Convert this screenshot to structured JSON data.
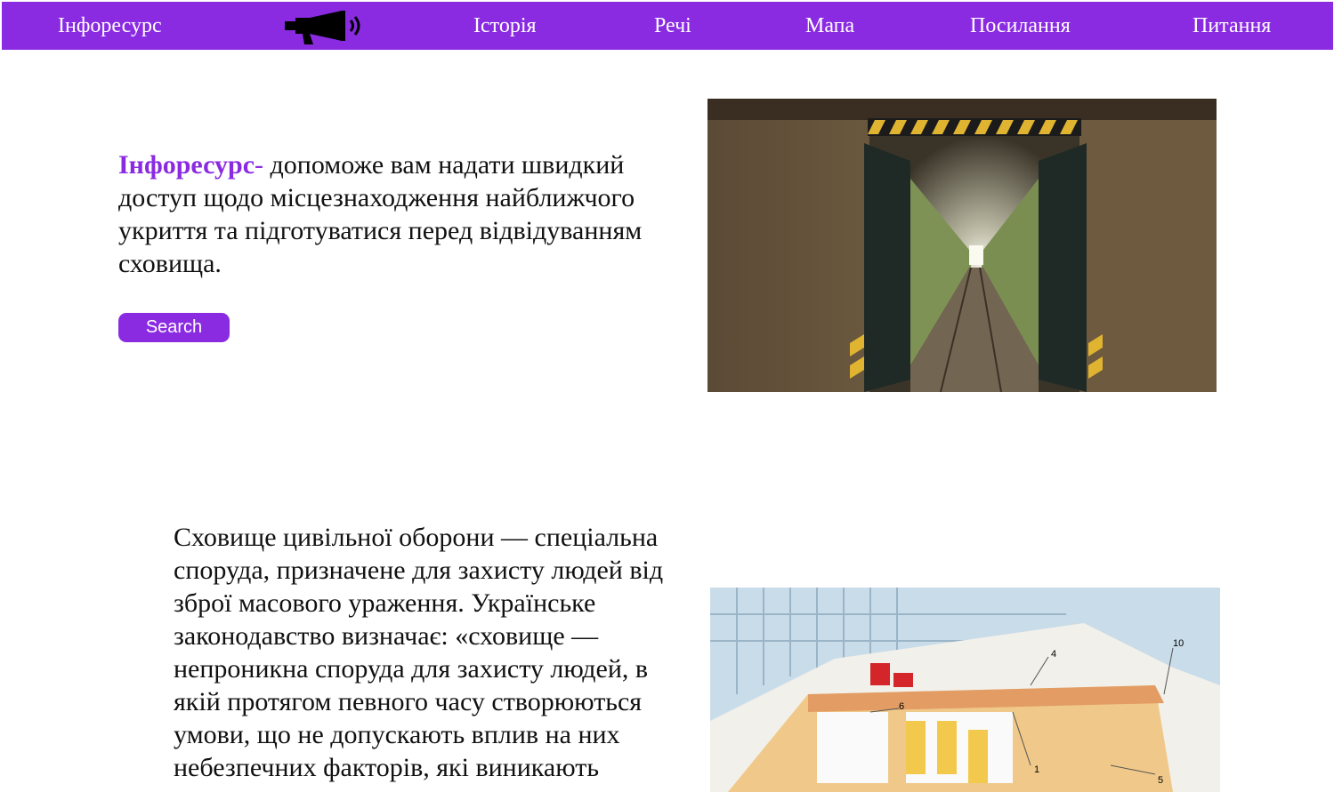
{
  "nav": {
    "brand": "Інфоресурс",
    "logo_icon": "megaphone-icon",
    "items": [
      "Історія",
      "Речі",
      "Мапа",
      "Посилання",
      "Питання"
    ]
  },
  "hero": {
    "brand_word": "Інфоресурс",
    "dash": "-",
    "text": " допоможе вам надати швидкий доступ щодо місцезнаходження найближчого укриття та підготуватися перед відвідуванням сховища.",
    "search_label": "Search"
  },
  "info": {
    "text": "Сховище цивільної оборони — спеціальна споруда, призначене для захисту людей від зброї масового ураження. Українське законодавство визначає: «сховище — непроникна споруда для захисту людей, в якій протягом певного часу створюються умови, що не допускають вплив на них небезпечних факторів, які виникають"
  },
  "diagram_labels": [
    "1",
    "4",
    "5",
    "6",
    "10"
  ],
  "colors": {
    "accent": "#8a2be2",
    "text": "#111111",
    "background": "#ffffff"
  }
}
